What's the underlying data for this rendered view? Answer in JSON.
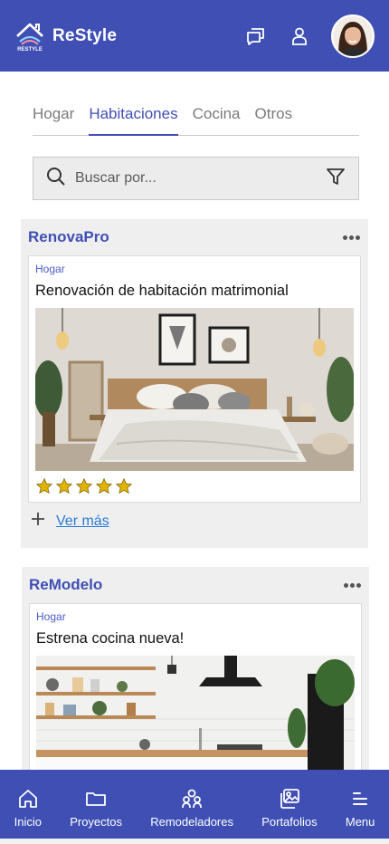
{
  "header": {
    "brand_name": "ReStyle",
    "logo_text": "RESTYLE",
    "icons": [
      "chat-icon",
      "user-icon"
    ],
    "avatar": "avatar"
  },
  "tabs": [
    {
      "label": "Hogar",
      "active": false
    },
    {
      "label": "Habitaciones",
      "active": true
    },
    {
      "label": "Cocina",
      "active": false
    },
    {
      "label": "Otros",
      "active": false
    }
  ],
  "search": {
    "placeholder": "Buscar por...",
    "value": ""
  },
  "posts": [
    {
      "company": "RenovaPro",
      "category": "Hogar",
      "title": "Renovación de habitación matrimonial",
      "rating": 5,
      "more_label": "Ver más"
    },
    {
      "company": "ReModelo",
      "category": "Hogar",
      "title": "Estrena cocina nueva!"
    }
  ],
  "nav": [
    {
      "label": "Inicio",
      "icon": "home-icon"
    },
    {
      "label": "Proyectos",
      "icon": "folder-icon"
    },
    {
      "label": "Remodeladores",
      "icon": "people-icon"
    },
    {
      "label": "Portafolios",
      "icon": "gallery-icon"
    },
    {
      "label": "Menu",
      "icon": "menu-icon"
    }
  ],
  "colors": {
    "primary": "#3f4fb4",
    "link": "#2b7bd6",
    "star": "#e2b400"
  }
}
